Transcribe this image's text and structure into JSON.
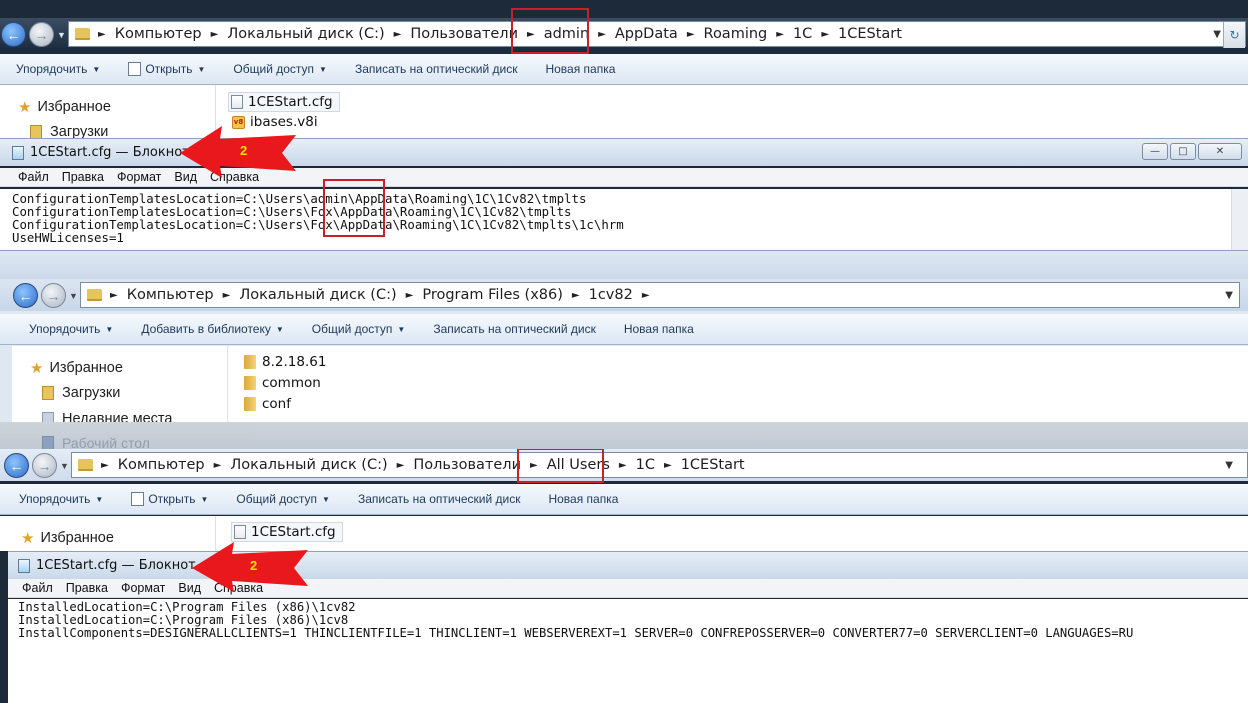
{
  "window1": {
    "breadcrumbs": [
      "Компьютер",
      "Локальный диск (C:)",
      "Пользователи",
      "admin",
      "AppData",
      "Roaming",
      "1C",
      "1CEStart"
    ],
    "toolbar": [
      "Упорядочить",
      "Открыть",
      "Общий доступ",
      "Записать на оптический диск",
      "Новая папка"
    ],
    "nav": [
      "Избранное",
      "Загрузки"
    ],
    "files": [
      "1CEStart.cfg",
      "ibases.v8i"
    ]
  },
  "notepad1": {
    "title": "1CEStart.cfg — Блокнот",
    "menu": [
      "Файл",
      "Правка",
      "Формат",
      "Вид",
      "Справка"
    ],
    "lines": [
      "ConfigurationTemplatesLocation=C:\\Users\\admin\\AppData\\Roaming\\1C\\1Cv82\\tmplts",
      "ConfigurationTemplatesLocation=C:\\Users\\Fox\\AppData\\Roaming\\1C\\1Cv82\\tmplts",
      "ConfigurationTemplatesLocation=C:\\Users\\Fox\\AppData\\Roaming\\1C\\1Cv82\\tmplts\\1c\\hrm",
      "UseHWLicenses=1"
    ],
    "arrow_label": "2"
  },
  "window2": {
    "breadcrumbs": [
      "Компьютер",
      "Локальный диск (C:)",
      "Program Files (x86)",
      "1cv82"
    ],
    "toolbar": [
      "Упорядочить",
      "Добавить в библиотеку",
      "Общий доступ",
      "Записать на оптический диск",
      "Новая папка"
    ],
    "nav": [
      "Избранное",
      "Загрузки",
      "Недавние места",
      "Рабочий стол"
    ],
    "files": [
      "8.2.18.61",
      "common",
      "conf"
    ]
  },
  "window3": {
    "breadcrumbs": [
      "Компьютер",
      "Локальный диск (C:)",
      "Пользователи",
      "All Users",
      "1C",
      "1CEStart"
    ],
    "toolbar": [
      "Упорядочить",
      "Открыть",
      "Общий доступ",
      "Записать на оптический диск",
      "Новая папка"
    ],
    "nav": [
      "Избранное"
    ],
    "files": [
      "1CEStart.cfg"
    ]
  },
  "notepad2": {
    "title": "1CEStart.cfg — Блокнот",
    "menu": [
      "Файл",
      "Правка",
      "Формат",
      "Вид",
      "Справка"
    ],
    "lines": [
      "InstalledLocation=C:\\Program Files (x86)\\1cv82",
      "InstalledLocation=C:\\Program Files (x86)\\1cv8",
      "InstallComponents=DESIGNERALLCLIENTS=1 THINCLIENTFILE=1 THINCLIENT=1 WEBSERVEREXT=1 SERVER=0 CONFREPOSSERVER=0 CONVERTER77=0 SERVERCLIENT=0 LANGUAGES=RU"
    ],
    "arrow_label": "2"
  },
  "colors": {
    "annotation_red": "#c8202a",
    "arrow_red": "#e8181c",
    "arrow_number": "#ffe400"
  }
}
